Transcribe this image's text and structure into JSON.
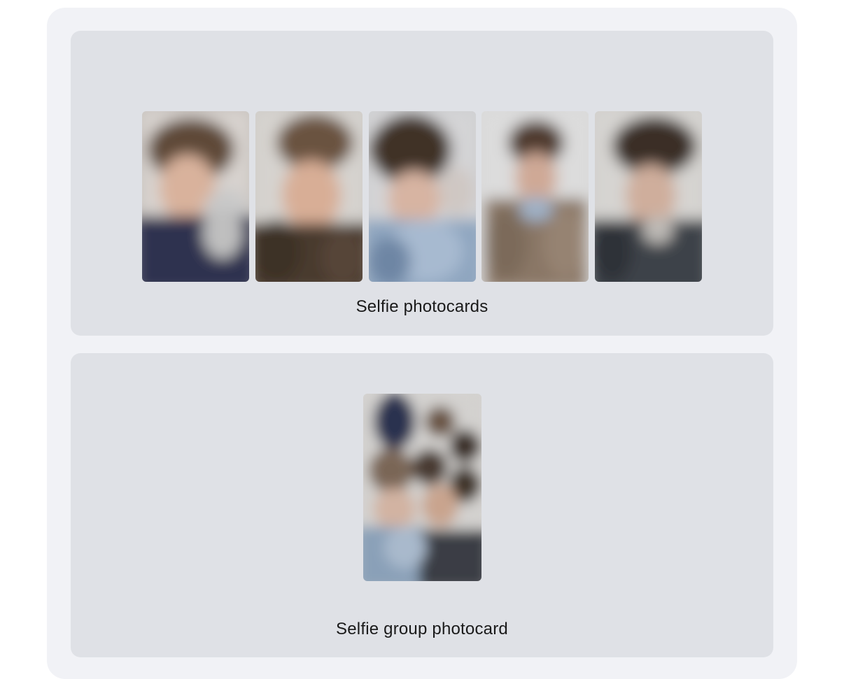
{
  "sections": [
    {
      "caption": "Selfie photocards",
      "image_count": 5,
      "image_label": "selfie-photocard"
    },
    {
      "caption": "Selfie group photocard",
      "image_count": 1,
      "image_label": "group-photocard"
    }
  ],
  "colors": {
    "page_background": "#ffffff",
    "container_background": "#f1f2f6",
    "panel_background": "#dfe1e6",
    "caption_text": "#1a1a1a"
  }
}
